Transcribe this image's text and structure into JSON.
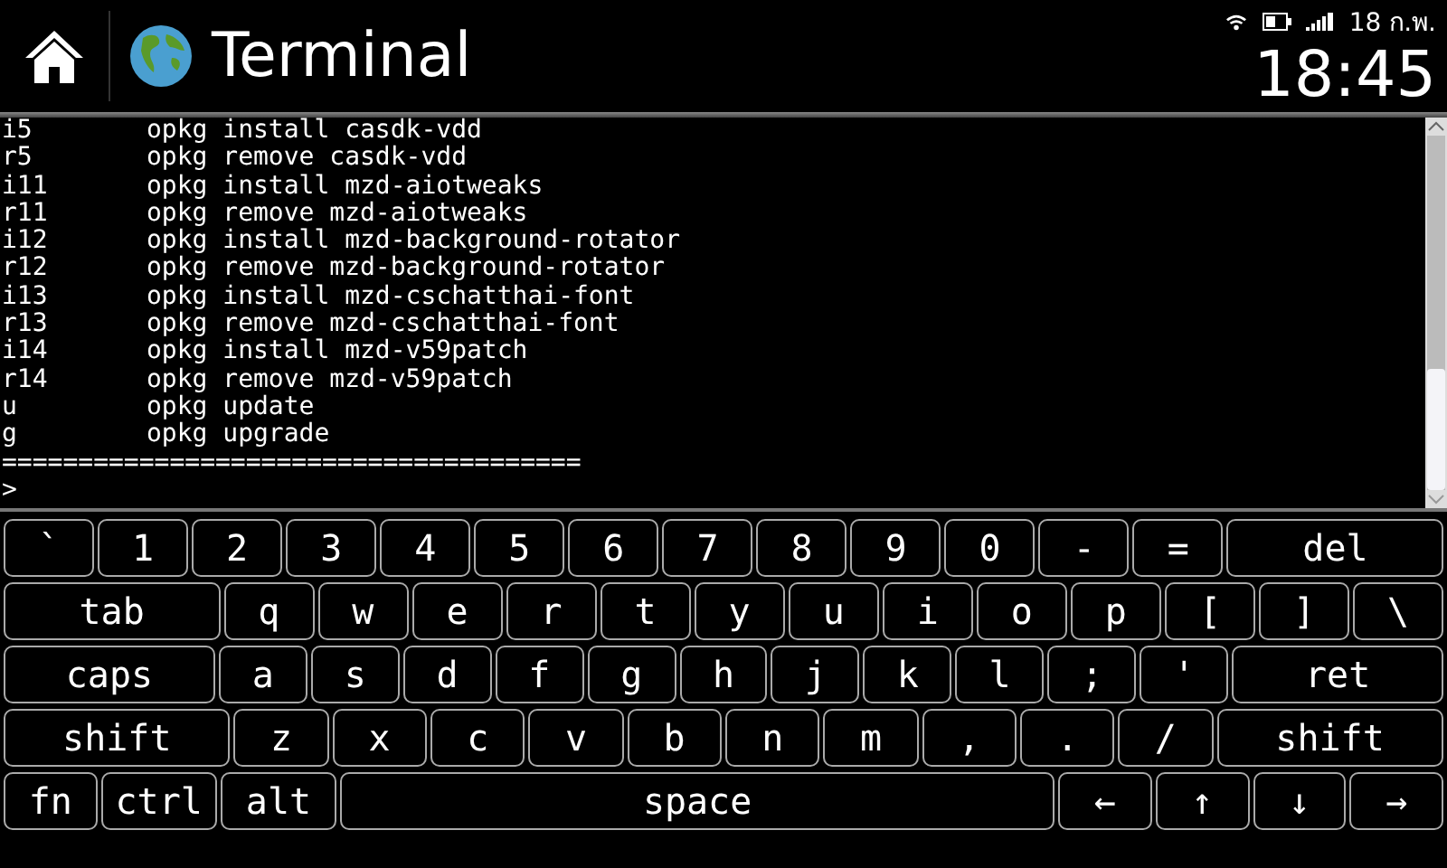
{
  "app_bar": {
    "title": "Terminal"
  },
  "status_bar": {
    "date": "18 ก.พ.",
    "clock": "18:45"
  },
  "terminal": {
    "lines": [
      {
        "key": "i5",
        "command": "opkg install casdk-vdd"
      },
      {
        "key": "r5",
        "command": "opkg remove casdk-vdd"
      },
      {
        "key": "i11",
        "command": "opkg install mzd-aiotweaks"
      },
      {
        "key": "r11",
        "command": "opkg remove mzd-aiotweaks"
      },
      {
        "key": "i12",
        "command": "opkg install mzd-background-rotator"
      },
      {
        "key": "r12",
        "command": "opkg remove mzd-background-rotator"
      },
      {
        "key": "i13",
        "command": "opkg install mzd-cschatthai-font"
      },
      {
        "key": "r13",
        "command": "opkg remove mzd-cschatthai-font"
      },
      {
        "key": "i14",
        "command": "opkg install mzd-v59patch"
      },
      {
        "key": "r14",
        "command": "opkg remove mzd-v59patch"
      },
      {
        "key": "u",
        "command": "opkg update"
      },
      {
        "key": "g",
        "command": "opkg upgrade"
      }
    ],
    "separator": "======================================",
    "prompt": ">"
  },
  "keyboard": {
    "rows": [
      {
        "keys": [
          {
            "label": "`",
            "kind": "char"
          },
          {
            "label": "1",
            "kind": "char"
          },
          {
            "label": "2",
            "kind": "char"
          },
          {
            "label": "3",
            "kind": "char"
          },
          {
            "label": "4",
            "kind": "char"
          },
          {
            "label": "5",
            "kind": "char"
          },
          {
            "label": "6",
            "kind": "char"
          },
          {
            "label": "7",
            "kind": "char"
          },
          {
            "label": "8",
            "kind": "char"
          },
          {
            "label": "9",
            "kind": "char"
          },
          {
            "label": "0",
            "kind": "char"
          },
          {
            "label": "-",
            "kind": "char"
          },
          {
            "label": "=",
            "kind": "char"
          },
          {
            "label": "del",
            "kind": "wide"
          }
        ]
      },
      {
        "keys": [
          {
            "label": "tab",
            "kind": "wide"
          },
          {
            "label": "q",
            "kind": "char"
          },
          {
            "label": "w",
            "kind": "char"
          },
          {
            "label": "e",
            "kind": "char"
          },
          {
            "label": "r",
            "kind": "char"
          },
          {
            "label": "t",
            "kind": "char"
          },
          {
            "label": "y",
            "kind": "char"
          },
          {
            "label": "u",
            "kind": "char"
          },
          {
            "label": "i",
            "kind": "char"
          },
          {
            "label": "o",
            "kind": "char"
          },
          {
            "label": "p",
            "kind": "char"
          },
          {
            "label": "[",
            "kind": "char"
          },
          {
            "label": "]",
            "kind": "char"
          },
          {
            "label": "\\",
            "kind": "char"
          }
        ]
      },
      {
        "keys": [
          {
            "label": "caps",
            "kind": "wide"
          },
          {
            "label": "a",
            "kind": "char"
          },
          {
            "label": "s",
            "kind": "char"
          },
          {
            "label": "d",
            "kind": "char"
          },
          {
            "label": "f",
            "kind": "char"
          },
          {
            "label": "g",
            "kind": "char"
          },
          {
            "label": "h",
            "kind": "char"
          },
          {
            "label": "j",
            "kind": "char"
          },
          {
            "label": "k",
            "kind": "char"
          },
          {
            "label": "l",
            "kind": "char"
          },
          {
            "label": ";",
            "kind": "char"
          },
          {
            "label": "'",
            "kind": "char"
          },
          {
            "label": "ret",
            "kind": "wide"
          }
        ]
      },
      {
        "keys": [
          {
            "label": "shift",
            "kind": "wide"
          },
          {
            "label": "z",
            "kind": "char"
          },
          {
            "label": "x",
            "kind": "char"
          },
          {
            "label": "c",
            "kind": "char"
          },
          {
            "label": "v",
            "kind": "char"
          },
          {
            "label": "b",
            "kind": "char"
          },
          {
            "label": "n",
            "kind": "char"
          },
          {
            "label": "m",
            "kind": "char"
          },
          {
            "label": ",",
            "kind": "char"
          },
          {
            "label": ".",
            "kind": "char"
          },
          {
            "label": "/",
            "kind": "char"
          },
          {
            "label": "shift",
            "kind": "wide"
          }
        ]
      },
      {
        "keys": [
          {
            "label": "fn",
            "kind": "char"
          },
          {
            "label": "ctrl",
            "kind": "mod"
          },
          {
            "label": "alt",
            "kind": "mod"
          },
          {
            "label": "space",
            "kind": "space"
          },
          {
            "label": "←",
            "kind": "char"
          },
          {
            "label": "↑",
            "kind": "char"
          },
          {
            "label": "↓",
            "kind": "char"
          },
          {
            "label": "→",
            "kind": "char"
          }
        ]
      }
    ]
  }
}
